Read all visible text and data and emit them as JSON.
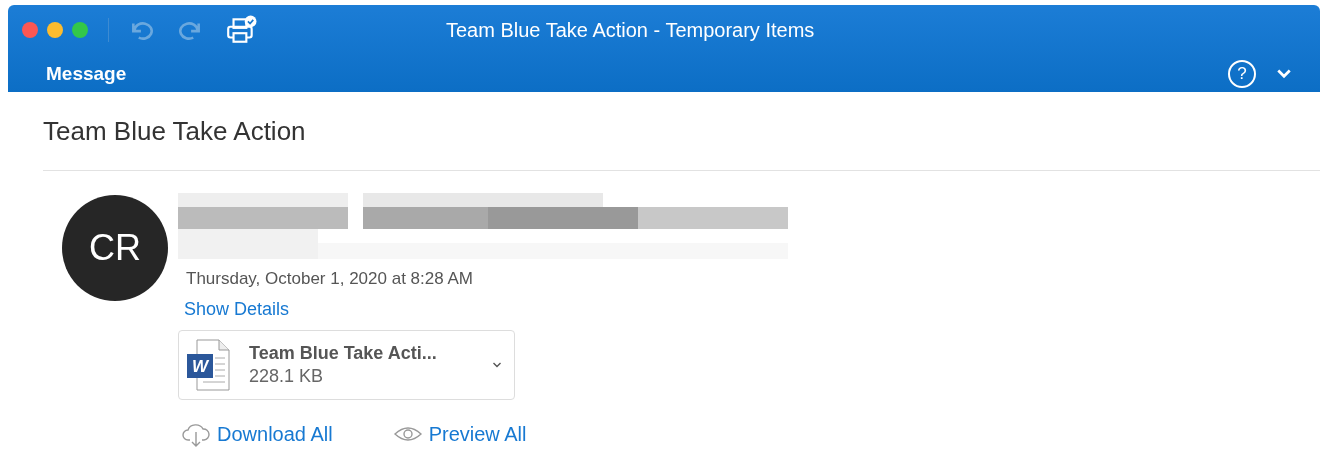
{
  "window": {
    "title": "Team Blue Take Action - Temporary Items"
  },
  "toolbar": [
    {
      "kind": "undo",
      "disabled": true
    },
    {
      "kind": "redo",
      "disabled": true
    },
    {
      "kind": "print",
      "disabled": false
    }
  ],
  "ribbon": {
    "tabs": [
      {
        "label": "Message",
        "selected": true
      }
    ],
    "help": "?"
  },
  "message": {
    "subject": "Team Blue Take Action",
    "avatar": "CR",
    "date": "Thursday, October 1, 2020 at 8:28 AM",
    "show_details": "Show Details",
    "attachments": [
      {
        "name": "Team Blue Take Acti...",
        "size": "228.1 KB",
        "icon_letter": "W"
      }
    ],
    "actions": [
      {
        "kind": "download",
        "label": "Download All"
      },
      {
        "kind": "preview",
        "label": "Preview All"
      }
    ]
  }
}
